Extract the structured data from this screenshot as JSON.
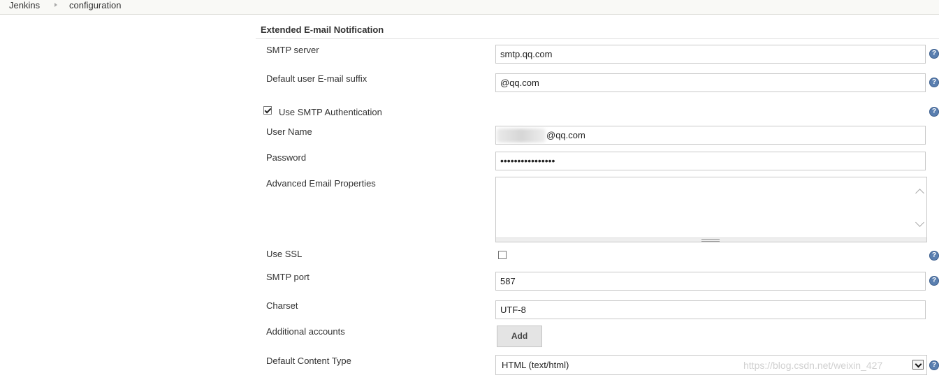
{
  "breadcrumb": {
    "items": [
      "Jenkins",
      "configuration"
    ]
  },
  "section": {
    "title": "Extended E-mail Notification"
  },
  "fields": {
    "smtp_server": {
      "label": "SMTP server",
      "value": "smtp.qq.com"
    },
    "default_suffix": {
      "label": "Default user E-mail suffix",
      "value": "@qq.com"
    },
    "use_smtp_auth": {
      "label": "Use SMTP Authentication",
      "checked": true
    },
    "user_name": {
      "label": "User Name",
      "value_visible": "@qq.com"
    },
    "password": {
      "label": "Password",
      "value": "••••••••••••••••"
    },
    "advanced_props": {
      "label": "Advanced Email Properties",
      "value": ""
    },
    "use_ssl": {
      "label": "Use SSL",
      "checked": false
    },
    "smtp_port": {
      "label": "SMTP port",
      "value": "587"
    },
    "charset": {
      "label": "Charset",
      "value": "UTF-8"
    },
    "additional_accounts": {
      "label": "Additional accounts",
      "button": "Add"
    },
    "content_type": {
      "label": "Default Content Type",
      "selected": "HTML (text/html)"
    }
  },
  "icons": {
    "help": "help-question-icon",
    "help_glyph": "?"
  },
  "watermark": "https://blog.csdn.net/weixin_427"
}
